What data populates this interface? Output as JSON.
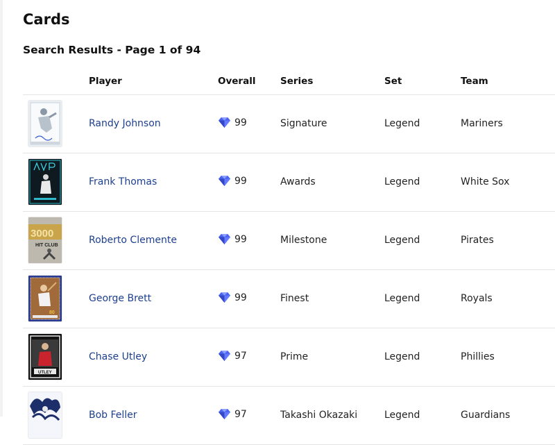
{
  "page": {
    "title": "Cards",
    "results_heading": "Search Results - Page 1 of 94"
  },
  "table": {
    "columns": {
      "player": "Player",
      "overall": "Overall",
      "series": "Series",
      "set": "Set",
      "team": "Team"
    },
    "rows": [
      {
        "player": "Randy Johnson",
        "overall": "99",
        "series": "Signature",
        "set": "Legend",
        "team": "Mariners"
      },
      {
        "player": "Frank Thomas",
        "overall": "99",
        "series": "Awards",
        "set": "Legend",
        "team": "White Sox"
      },
      {
        "player": "Roberto Clemente",
        "overall": "99",
        "series": "Milestone",
        "set": "Legend",
        "team": "Pirates"
      },
      {
        "player": "George Brett",
        "overall": "99",
        "series": "Finest",
        "set": "Legend",
        "team": "Royals"
      },
      {
        "player": "Chase Utley",
        "overall": "97",
        "series": "Prime",
        "set": "Legend",
        "team": "Phillies"
      },
      {
        "player": "Bob Feller",
        "overall": "97",
        "series": "Takashi Okazaki",
        "set": "Legend",
        "team": "Guardians"
      }
    ]
  },
  "colors": {
    "link": "#1d3f8f",
    "gem": "#4a63f0",
    "divider": "#e4e4e4"
  },
  "icons": {
    "rarity": "diamond-gem-icon"
  }
}
